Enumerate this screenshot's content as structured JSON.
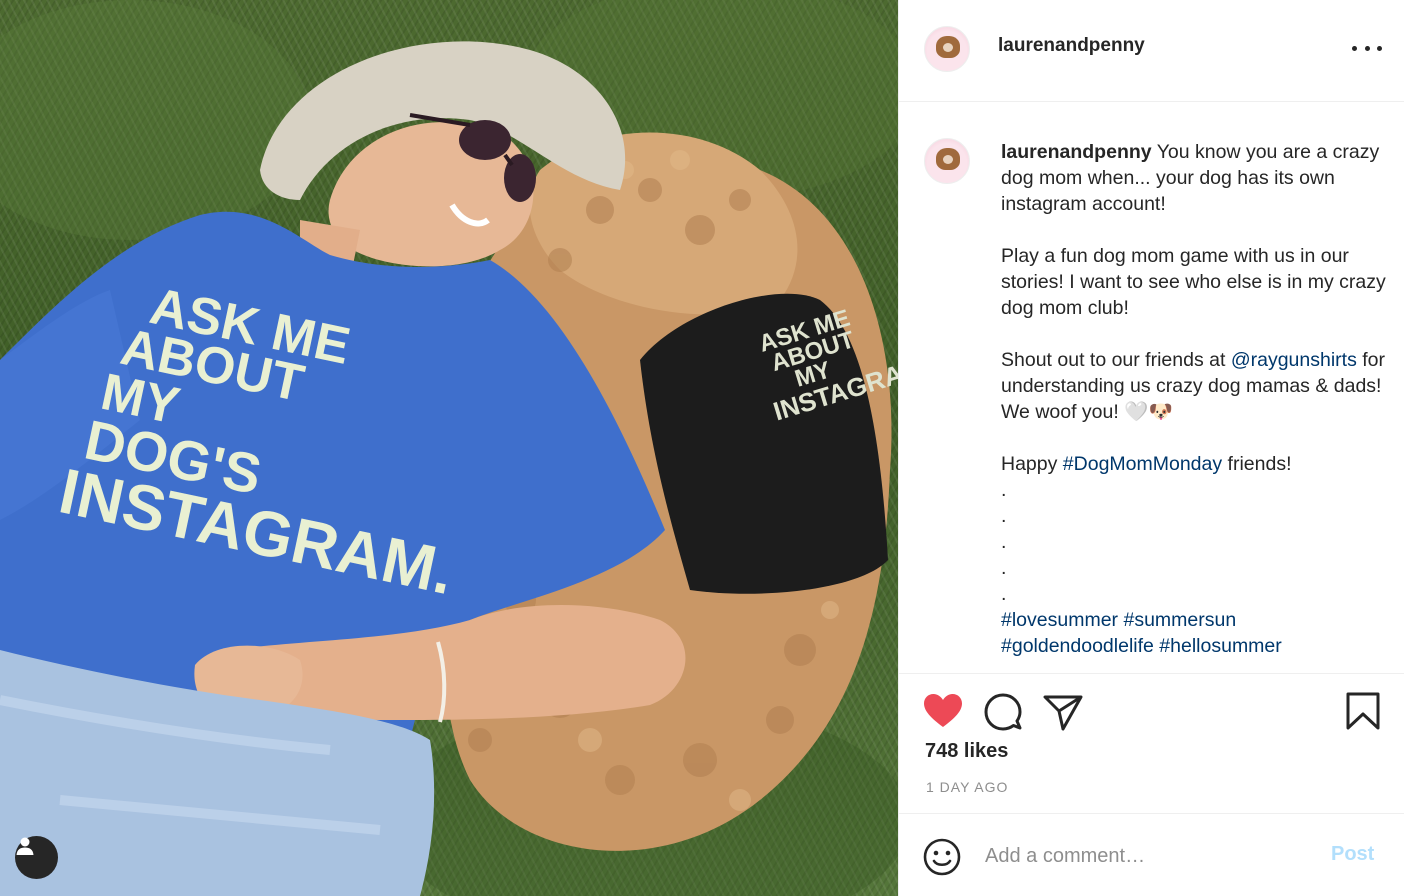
{
  "post": {
    "username": "laurenandpenny",
    "image_alt": "Woman in blue t-shirt lying on grass beside a curly dog wearing a black shirt",
    "shirt_lines": [
      "ASK ME",
      "ABOUT",
      "MY",
      "DOG'S",
      "INSTAGRAM."
    ],
    "dog_shirt_lines": [
      "ASK ME",
      "ABOUT",
      "MY",
      "INSTAGRAM"
    ]
  },
  "caption": {
    "username": "laurenandpenny",
    "p1": " You know you are a crazy dog mom when... your dog has its own instagram account!",
    "p2": "Play a fun dog mom game with us in our stories! I want to see who else is in my crazy dog mom club!",
    "p3a": "Shout out to our friends at ",
    "mention": "@raygunshirts",
    "p3b": " for understanding us crazy dog mamas & dads! We woof you! 🤍🐶",
    "p4a": "Happy ",
    "hashtag1": "#DogMomMonday",
    "p4b": " friends!",
    "dots": ".\n.\n.\n.\n.",
    "hashtag2": "#lovesummer",
    "hashtag3": "#summersun",
    "hashtag_more": "#goldendoodlelife #hellosummer"
  },
  "actions": {
    "likes": "748 likes",
    "date": "1 DAY AGO"
  },
  "comment": {
    "placeholder": "Add a comment…",
    "post_label": "Post"
  },
  "colors": {
    "like_red": "#ed4956",
    "link_blue": "#00376b",
    "post_disabled": "#b2dffc"
  },
  "icons": [
    "heart-icon",
    "comment-icon",
    "share-icon",
    "bookmark-icon",
    "emoji-icon",
    "more-icon",
    "user-icon"
  ]
}
